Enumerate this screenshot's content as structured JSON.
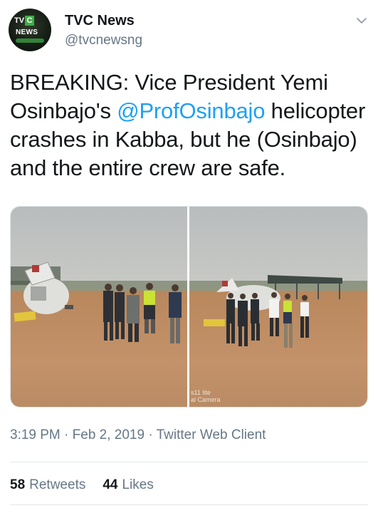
{
  "account": {
    "name": "TVC News",
    "handle": "@tvcnewsng",
    "avatar_logo": {
      "top": "TV",
      "accent": "C",
      "bottom": "NEWS"
    }
  },
  "tweet": {
    "text_before": "BREAKING: Vice President Yemi Osinbajo's ",
    "mention": "@ProfOsinbajo",
    "text_after": " helicopter crashes in Kabba, but he (Osinbajo) and the entire crew are safe."
  },
  "media": {
    "photos": [
      {
        "alt_name": "crash-photo-1"
      },
      {
        "alt_name": "crash-photo-2",
        "watermark": "s11 lite\nal Camera"
      }
    ]
  },
  "meta": {
    "time": "3:19 PM",
    "date": "Feb 2, 2019",
    "client": "Twitter Web Client"
  },
  "stats": {
    "retweets_count": "58",
    "retweets_label": "Retweets",
    "likes_count": "44",
    "likes_label": "Likes"
  },
  "colors": {
    "link": "#1da1f2",
    "text": "#14171a",
    "muted": "#657786",
    "brand_green": "#3fae49"
  }
}
